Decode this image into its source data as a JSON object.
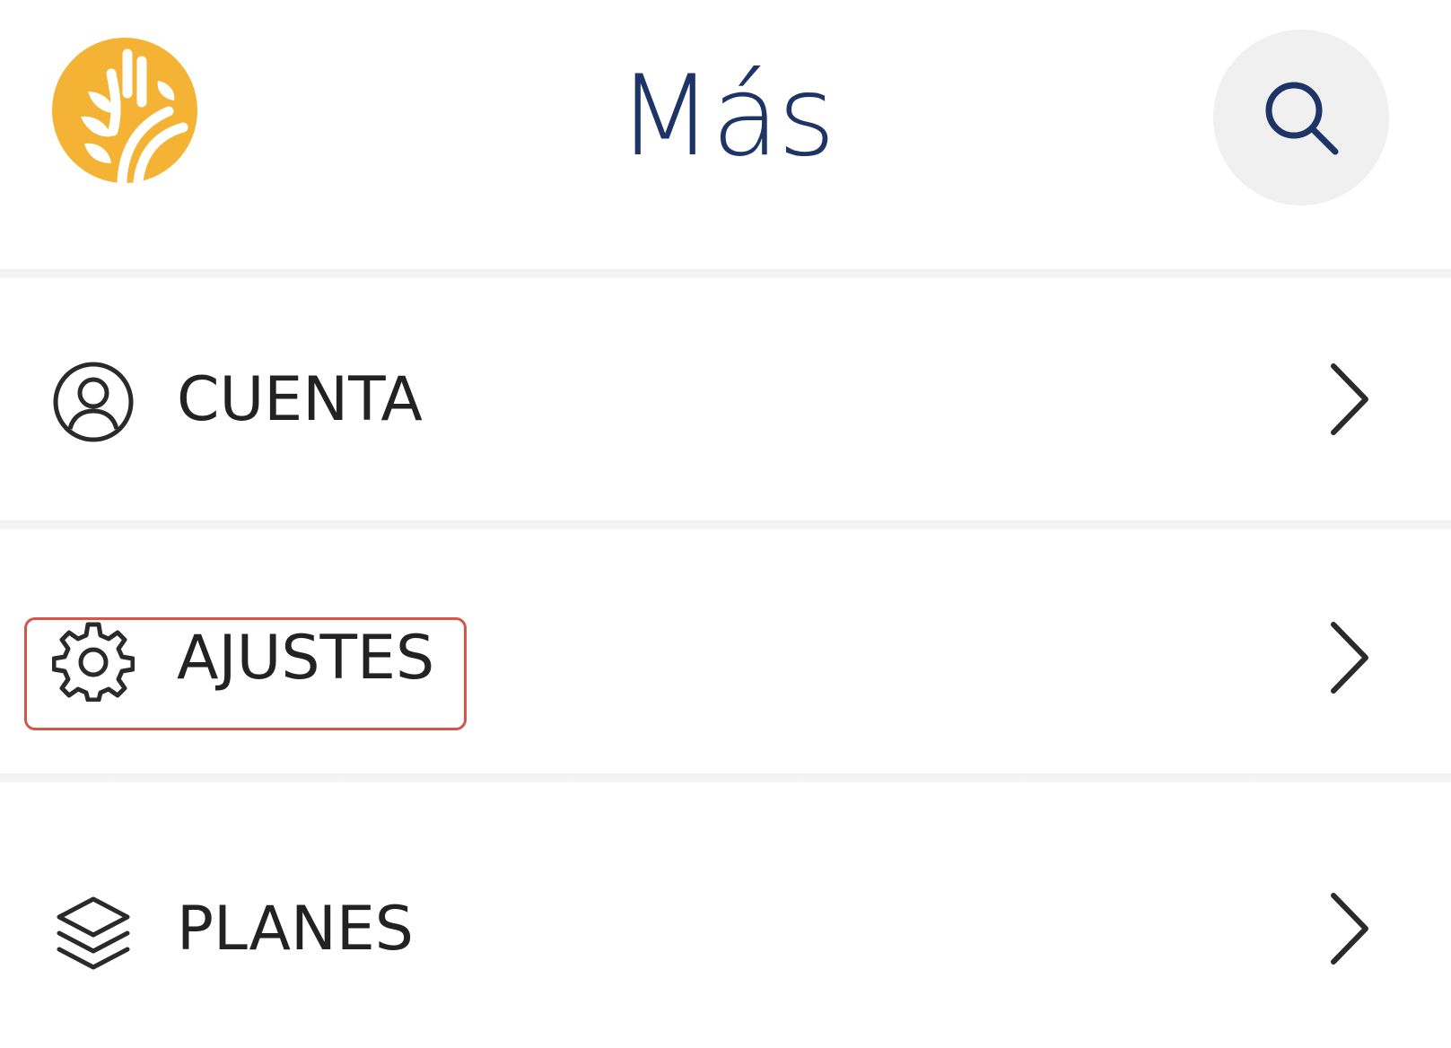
{
  "header": {
    "title": "Más",
    "logo_icon": "wheat-leaf-logo",
    "search_icon": "search-icon"
  },
  "menu": {
    "items": [
      {
        "label": "CUENTA",
        "icon": "user-circle-icon"
      },
      {
        "label": "AJUSTES",
        "icon": "gear-icon",
        "highlighted": true
      },
      {
        "label": "PLANES",
        "icon": "layers-icon"
      }
    ]
  },
  "colors": {
    "logo": "#f5b335",
    "title": "#1f3466",
    "search_bg": "#f0f0f0",
    "highlight_border": "#d9534a",
    "label_text": "#222222"
  }
}
